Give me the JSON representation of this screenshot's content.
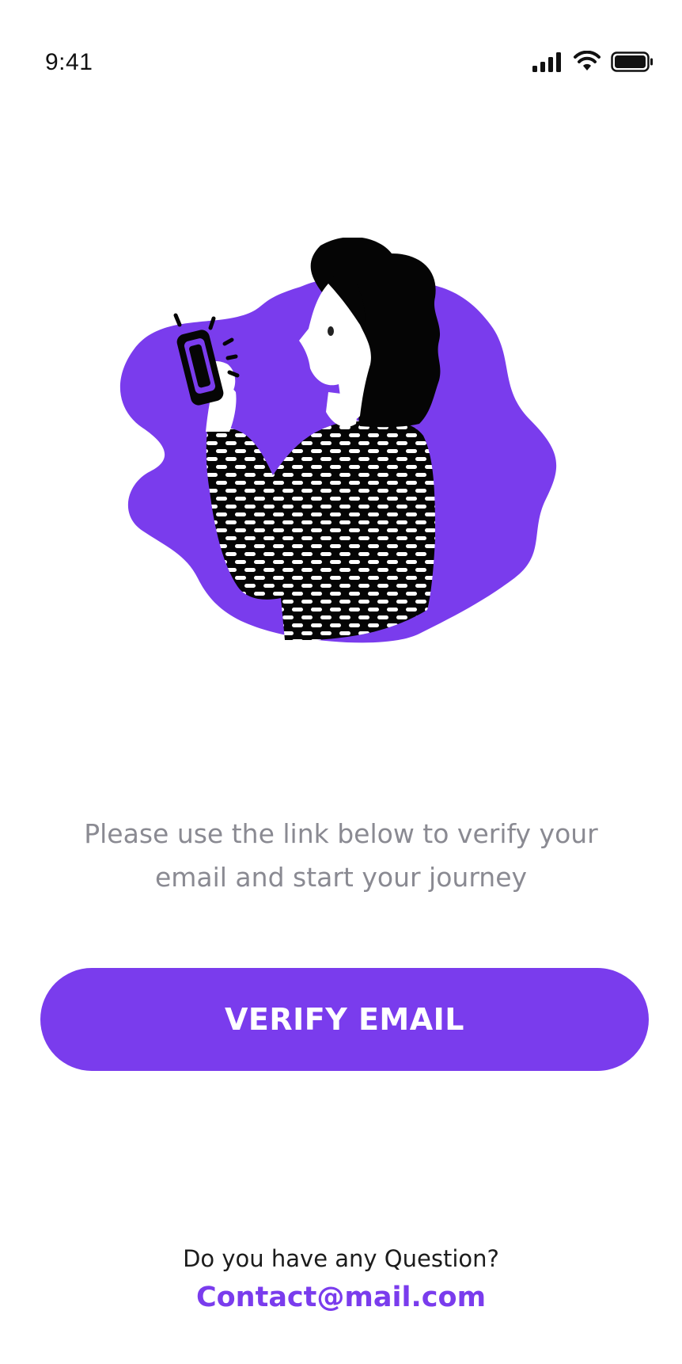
{
  "status_bar": {
    "time": "9:41",
    "icons": [
      "cellular-signal-icon",
      "wifi-icon",
      "battery-icon"
    ]
  },
  "illustration": {
    "name": "woman-with-phone-illustration"
  },
  "message": {
    "line1": "Please use the link below to verify your",
    "line2": "email and start your journey"
  },
  "verify_button": {
    "label": "VERIFY EMAIL"
  },
  "footer": {
    "question": "Do you have any Question?",
    "contact": "Contact@mail.com"
  },
  "colors": {
    "accent": "#7a3ced",
    "text_muted": "#8a8a92",
    "text_dark": "#1c1c1c",
    "background": "#ffffff"
  }
}
